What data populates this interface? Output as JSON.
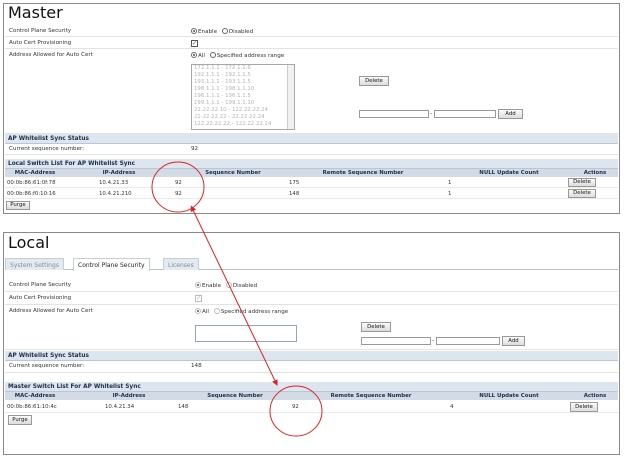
{
  "colors": {
    "annotation": "#e02020",
    "section_header_bg": "#dde5ee",
    "table_header_bg": "#d2dbe6",
    "active_radio": "#2a6f2a"
  },
  "master": {
    "title": "Master",
    "control_plane_security": {
      "label": "Control Plane Security",
      "options": [
        "Enable",
        "Disabled"
      ],
      "selected": "Enable"
    },
    "auto_cert": {
      "label": "Auto Cert Provisioning",
      "checked": true
    },
    "address_allowed": {
      "label": "Address Allowed for Auto Cert",
      "options": [
        "All",
        "Specified address range"
      ],
      "selected": "All"
    },
    "address_list": [
      "172.1.1.1 - 172.1.1.6",
      "192.1.1.1 - 192.1.1.5",
      "193.1.1.1 - 193.1.1.5",
      "198.1.1.1 - 198.1.1.10",
      "196.1.1.1 - 196.1.1.5",
      "199.1.1.1 - 199.1.1.10",
      "22.22.22.10 - 122.22.22.24",
      "22.22.22.22 - 22.22.22.24",
      "122.22.22.22 - 122.22.22.24"
    ],
    "delete_label": "Delete",
    "add_label": "Add",
    "range_separator": "-",
    "sync_status": {
      "header": "AP Whitelist Sync Status",
      "current_seq_label": "Current sequence number:",
      "current_seq_value": "92"
    },
    "switch_list": {
      "header": "Local Switch List For AP Whitelist Sync",
      "columns": [
        "MAC-Address",
        "IP-Address",
        "Sequence Number",
        "Remote Sequence Number",
        "NULL Update Count",
        "Actions"
      ],
      "rows": [
        {
          "mac": "00:0b:86:61:0f:78",
          "ip": "10.4.21.33",
          "seq": "92",
          "remote": "175",
          "null": "1",
          "action": "Delete"
        },
        {
          "mac": "00:0b:86:f0:10:16",
          "ip": "10.4.21.210",
          "seq": "92",
          "remote": "148",
          "null": "1",
          "action": "Delete"
        }
      ],
      "purge_label": "Purge"
    }
  },
  "local": {
    "title": "Local",
    "tabs": [
      "System Settings",
      "Control Plane Security",
      "Licenses"
    ],
    "active_tab": "Control Plane Security",
    "control_plane_security": {
      "label": "Control Plane Security",
      "options": [
        "Enable",
        "Disabled"
      ],
      "selected": "Enable"
    },
    "auto_cert": {
      "label": "Auto Cert Provisioning",
      "checked": true
    },
    "address_allowed": {
      "label": "Address Allowed for Auto Cert",
      "options": [
        "All",
        "Specified address range"
      ],
      "selected": "All"
    },
    "delete_label": "Delete",
    "add_label": "Add",
    "range_separator": "-",
    "sync_status": {
      "header": "AP Whitelist Sync Status",
      "current_seq_label": "Current sequence number:",
      "current_seq_value": "148"
    },
    "switch_list": {
      "header": "Master Switch List For AP Whitelist Sync",
      "columns": [
        "MAC-Address",
        "IP-Address",
        "Sequence Number",
        "Remote Sequence Number",
        "NULL Update Count",
        "Actions"
      ],
      "rows": [
        {
          "mac": "00:0b:86:61:10:4c",
          "ip": "10.4.21.34",
          "seq": "148",
          "remote": "92",
          "null": "4",
          "action": "Delete"
        }
      ],
      "purge_label": "Purge"
    }
  }
}
